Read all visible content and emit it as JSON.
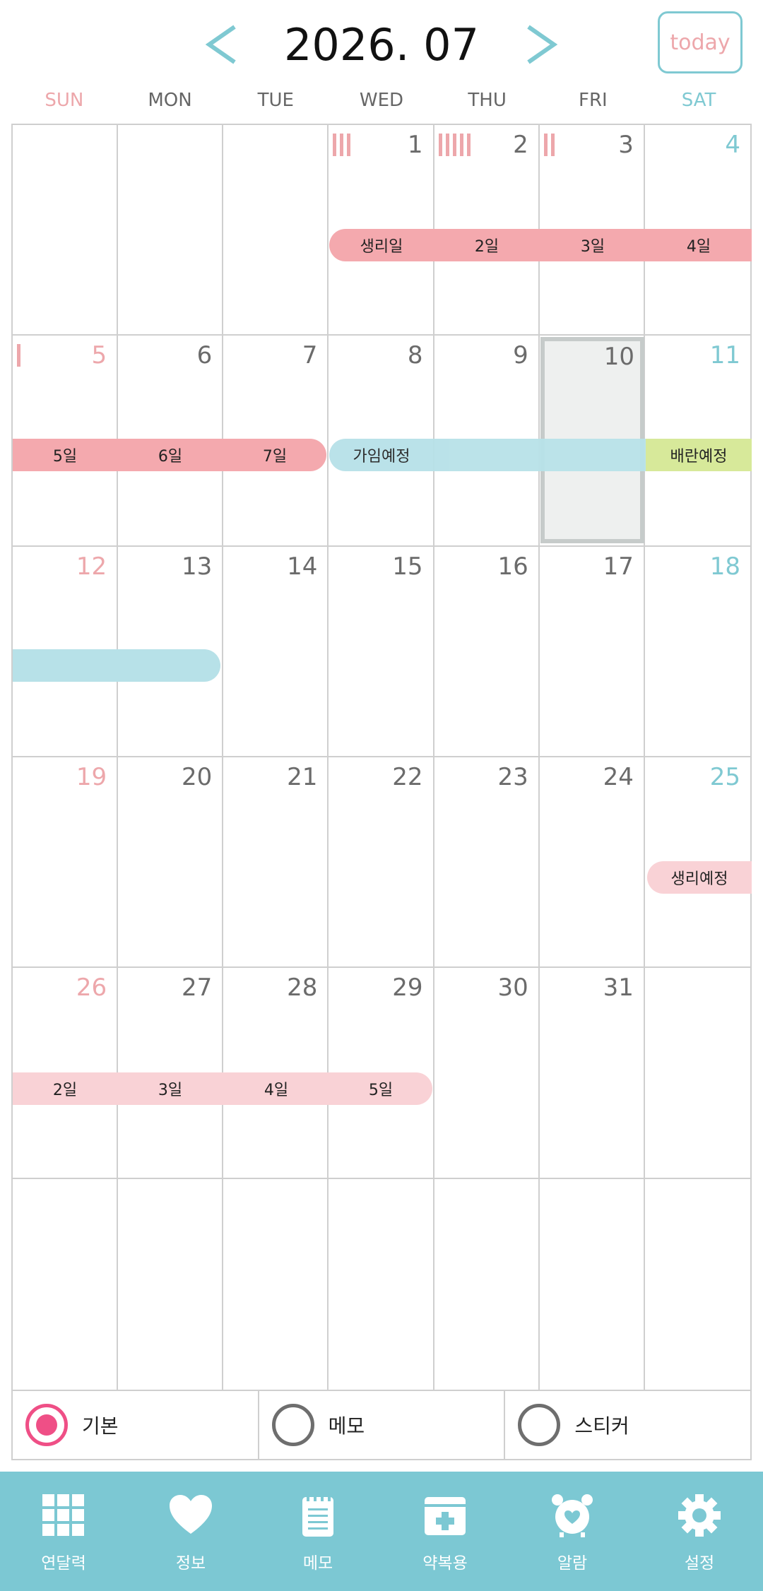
{
  "header": {
    "title": "2026. 07",
    "prev_icon": "chevron-left-icon",
    "next_icon": "chevron-right-icon",
    "today_label": "today"
  },
  "colors": {
    "accent": "#7cc8d3",
    "sunday": "#eda7ab",
    "saturday": "#7fc9d2",
    "period": "#f4a9ae",
    "period_expected": "#f9d2d6",
    "fertile": "#b7e1e8",
    "ovulation": "#d7e99a",
    "radio_selected": "#ef4f86"
  },
  "weekdays": [
    "SUN",
    "MON",
    "TUE",
    "WED",
    "THU",
    "FRI",
    "SAT"
  ],
  "days": {
    "d1": "1",
    "d2": "2",
    "d3": "3",
    "d4": "4",
    "d5": "5",
    "d6": "6",
    "d7": "7",
    "d8": "8",
    "d9": "9",
    "d10": "10",
    "d11": "11",
    "d12": "12",
    "d13": "13",
    "d14": "14",
    "d15": "15",
    "d16": "16",
    "d17": "17",
    "d18": "18",
    "d19": "19",
    "d20": "20",
    "d21": "21",
    "d22": "22",
    "d23": "23",
    "d24": "24",
    "d25": "25",
    "d26": "26",
    "d27": "27",
    "d28": "28",
    "d29": "29",
    "d30": "30",
    "d31": "31"
  },
  "selected_day": "10",
  "tally_marks": {
    "d1": 3,
    "d2": 5,
    "d3": 2,
    "d5": 1
  },
  "events": {
    "week1_period": [
      "생리일",
      "2일",
      "3일",
      "4일"
    ],
    "week2_period": [
      "5일",
      "6일",
      "7일"
    ],
    "week2_fertile": "가임예정",
    "week2_ovulation": "배란예정",
    "week4_expected": "생리예정",
    "week5_expected": [
      "2일",
      "3일",
      "4일",
      "5일"
    ]
  },
  "modes": [
    {
      "label": "기본",
      "selected": true
    },
    {
      "label": "메모",
      "selected": false
    },
    {
      "label": "스티커",
      "selected": false
    }
  ],
  "tabs": [
    {
      "label": "연달력",
      "icon": "calendar-grid-icon"
    },
    {
      "label": "정보",
      "icon": "heart-icon"
    },
    {
      "label": "메모",
      "icon": "notepad-icon"
    },
    {
      "label": "약복용",
      "icon": "medicine-box-icon"
    },
    {
      "label": "알람",
      "icon": "alarm-clock-icon"
    },
    {
      "label": "설정",
      "icon": "gear-icon"
    }
  ]
}
